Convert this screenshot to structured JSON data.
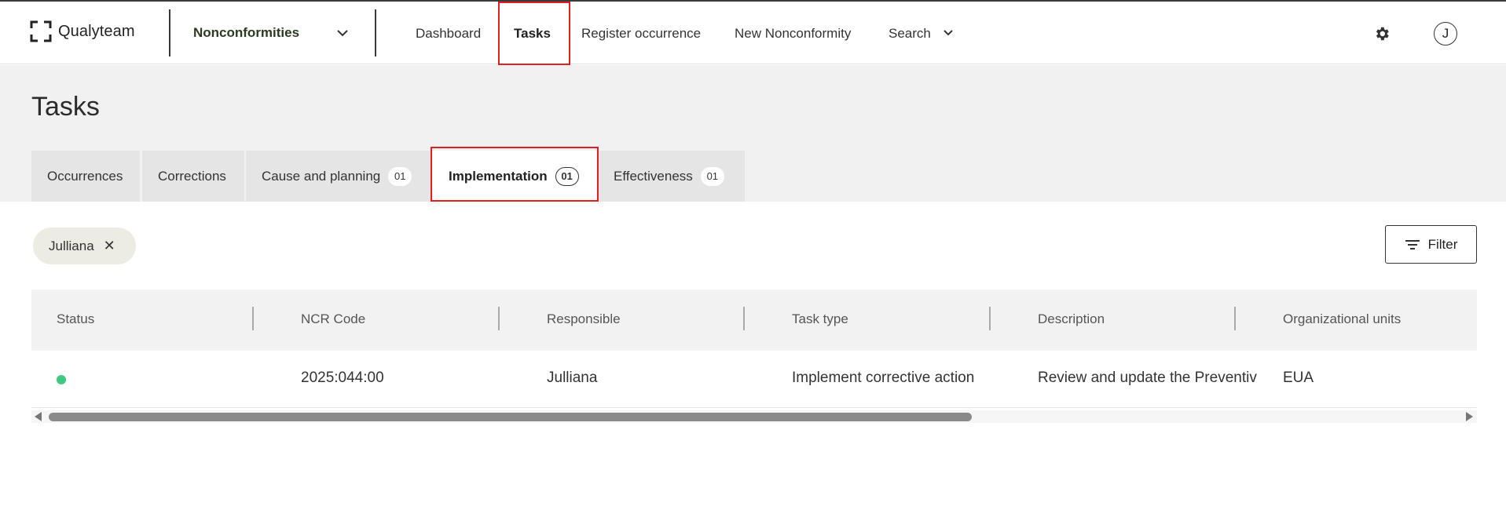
{
  "header": {
    "brand": "Qualyteam",
    "module_select": "Nonconformities",
    "nav": {
      "dashboard": "Dashboard",
      "tasks": "Tasks",
      "register_occurrence": "Register occurrence",
      "new_nonconformity": "New Nonconformity",
      "search": "Search"
    },
    "avatar_initial": "J",
    "icons": [
      "logo-brackets-icon",
      "chevron-down-icon",
      "gear-icon"
    ]
  },
  "page": {
    "title": "Tasks"
  },
  "tabs": [
    {
      "label": "Occurrences",
      "count": ""
    },
    {
      "label": "Corrections",
      "count": ""
    },
    {
      "label": "Cause and planning",
      "count": "01"
    },
    {
      "label": "Implementation",
      "count": "01",
      "active": true
    },
    {
      "label": "Effectiveness",
      "count": "01"
    }
  ],
  "filters": {
    "chip_label": "Julliana",
    "filter_button": "Filter"
  },
  "table": {
    "columns": [
      "Status",
      "NCR Code",
      "Responsible",
      "Task type",
      "Description",
      "Organizational units"
    ],
    "rows": [
      {
        "status_color": "#3ec97f",
        "ncr_code": "2025:044:00",
        "responsible": "Julliana",
        "task_type": "Implement corrective action",
        "description": "Review and update the Preventiv",
        "org_units": "EUA"
      }
    ]
  },
  "colors": {
    "highlight": "#e02020",
    "status_ok": "#3ec97f",
    "band": "#f1f1f1",
    "chip_bg": "#ecece2"
  }
}
